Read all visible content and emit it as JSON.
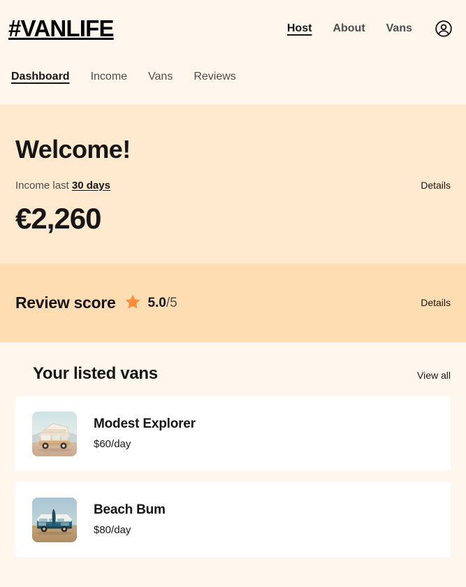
{
  "header": {
    "brand": "#VANLIFE",
    "nav": [
      {
        "label": "Host",
        "active": true
      },
      {
        "label": "About",
        "active": false
      },
      {
        "label": "Vans",
        "active": false
      }
    ],
    "account_icon": "account-circle-icon"
  },
  "host_nav": {
    "items": [
      {
        "label": "Dashboard",
        "active": true
      },
      {
        "label": "Income",
        "active": false
      },
      {
        "label": "Vans",
        "active": false
      },
      {
        "label": "Reviews",
        "active": false
      }
    ]
  },
  "income": {
    "welcome_title": "Welcome!",
    "caption_prefix": "Income last ",
    "caption_period": "30 days",
    "details_label": "Details",
    "amount": "€2,260"
  },
  "review": {
    "heading": "Review score",
    "star_icon": "star-icon",
    "score": "5.0",
    "denominator": "/5",
    "details_label": "Details"
  },
  "vans": {
    "title": "Your listed vans",
    "view_all_label": "View all",
    "items": [
      {
        "name": "Modest Explorer",
        "price": "$60/day",
        "thumb_name": "van-thumbnail-modest-explorer"
      },
      {
        "name": "Beach Bum",
        "price": "$80/day",
        "thumb_name": "van-thumbnail-beach-bum"
      }
    ]
  },
  "colors": {
    "page_background": "#FFF7ED",
    "income_background": "#FFEAD0",
    "review_background": "#FFDDB2",
    "card_background": "#FFFFFF",
    "text_primary": "#161616",
    "text_muted": "#4D4D4D",
    "star": "#FF8C38"
  }
}
